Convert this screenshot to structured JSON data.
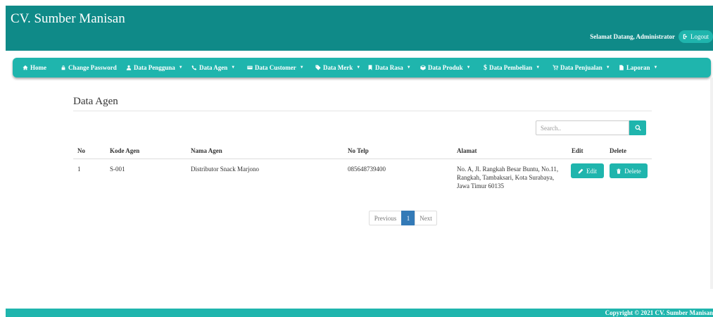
{
  "header": {
    "brand": "CV. Sumber Manisan",
    "welcome": "Selamat Datang, Administrator",
    "logout_label": "Logout"
  },
  "nav": {
    "items": [
      {
        "label": "Home",
        "icon": "home-icon",
        "dropdown": false
      },
      {
        "label": "Change Password",
        "icon": "lock-icon",
        "dropdown": false
      },
      {
        "label": "Data Pengguna",
        "icon": "user-icon",
        "dropdown": true
      },
      {
        "label": "Data Agen",
        "icon": "phone-icon",
        "dropdown": true
      },
      {
        "label": "Data Customer",
        "icon": "card-icon",
        "dropdown": true
      },
      {
        "label": "Data Merk",
        "icon": "tag-icon",
        "dropdown": true
      },
      {
        "label": "Data Rasa",
        "icon": "bookmark-icon",
        "dropdown": true
      },
      {
        "label": "Data Produk",
        "icon": "box-icon",
        "dropdown": true
      },
      {
        "label": "Data Pembelian",
        "icon": "dollar-icon",
        "dropdown": true
      },
      {
        "label": "Data Penjualan",
        "icon": "cart-icon",
        "dropdown": true
      },
      {
        "label": "Laporan",
        "icon": "file-icon",
        "dropdown": true
      }
    ]
  },
  "main": {
    "title": "Data Agen",
    "search": {
      "placeholder": "Search..",
      "value": ""
    },
    "table": {
      "columns": [
        "No",
        "Kode Agen",
        "Nama Agen",
        "No Telp",
        "Alamat",
        "Edit",
        "Delete"
      ],
      "rows": [
        {
          "no": "1",
          "kode": "S-001",
          "nama": "Distributor Snack Marjono",
          "telp": "085648739400",
          "alamat": "No. A, Jl. Rangkah Besar Buntu, No.11, Rangkah, Tambaksari, Kota Surabaya, Jawa Timur 60135",
          "edit_label": "Edit",
          "delete_label": "Delete"
        }
      ]
    },
    "pagination": {
      "previous": "Previous",
      "current": "1",
      "next": "Next"
    }
  },
  "footer": {
    "copyright": "Copyright © 2021 CV. Sumber Manisan"
  },
  "colors": {
    "header": "#0f8a88",
    "accent": "#1fb5ad",
    "active_page": "#337ab7"
  }
}
